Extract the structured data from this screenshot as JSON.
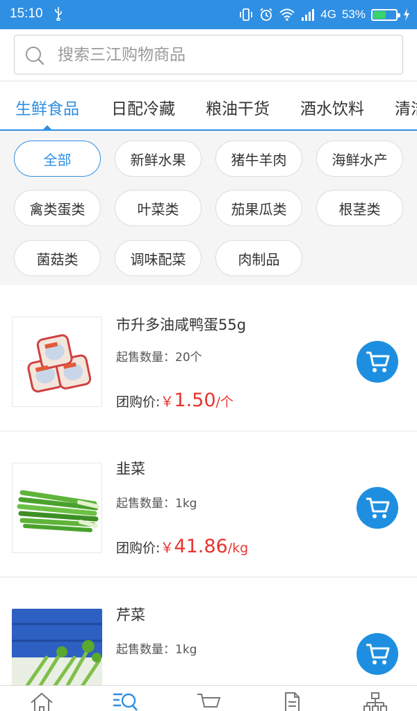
{
  "status_bar": {
    "time": "15:10",
    "network": "4G",
    "battery": "53%",
    "battery_level": 0.53,
    "bg_color": "#2f8fe3"
  },
  "search": {
    "placeholder": "搜索三江购物商品"
  },
  "tabs": [
    {
      "label": "生鲜食品",
      "active": true
    },
    {
      "label": "日配冷藏"
    },
    {
      "label": "粮油干货"
    },
    {
      "label": "酒水饮料"
    },
    {
      "label": "清洁"
    }
  ],
  "categories": [
    {
      "label": "全部",
      "active": true
    },
    {
      "label": "新鲜水果"
    },
    {
      "label": "猪牛羊肉"
    },
    {
      "label": "海鲜水产"
    },
    {
      "label": "禽类蛋类"
    },
    {
      "label": "叶菜类"
    },
    {
      "label": "茄果瓜类"
    },
    {
      "label": "根茎类"
    },
    {
      "label": "菌菇类"
    },
    {
      "label": "调味配菜"
    },
    {
      "label": "肉制品"
    }
  ],
  "product_labels": {
    "min_qty_label": "起售数量：",
    "price_label": "团购价:",
    "currency": "￥"
  },
  "products": [
    {
      "name": "市升多油咸鸭蛋55g",
      "min_qty": "20个",
      "price": "1.50",
      "unit": "/个",
      "image": "salted-duck-eggs"
    },
    {
      "name": "韭菜",
      "min_qty": "1kg",
      "price": "41.86",
      "unit": "/kg",
      "image": "chives"
    },
    {
      "name": "芹菜",
      "min_qty": "1kg",
      "price": "",
      "unit": "",
      "image": "celery"
    }
  ],
  "bottom_nav": [
    {
      "icon": "home-icon"
    },
    {
      "icon": "category-search-icon",
      "active": true
    },
    {
      "icon": "cart-icon"
    },
    {
      "icon": "orders-icon"
    },
    {
      "icon": "profile-network-icon"
    }
  ],
  "colors": {
    "accent": "#2f8fe3",
    "price": "#e8352f",
    "cart_button": "#1e8fe0"
  }
}
